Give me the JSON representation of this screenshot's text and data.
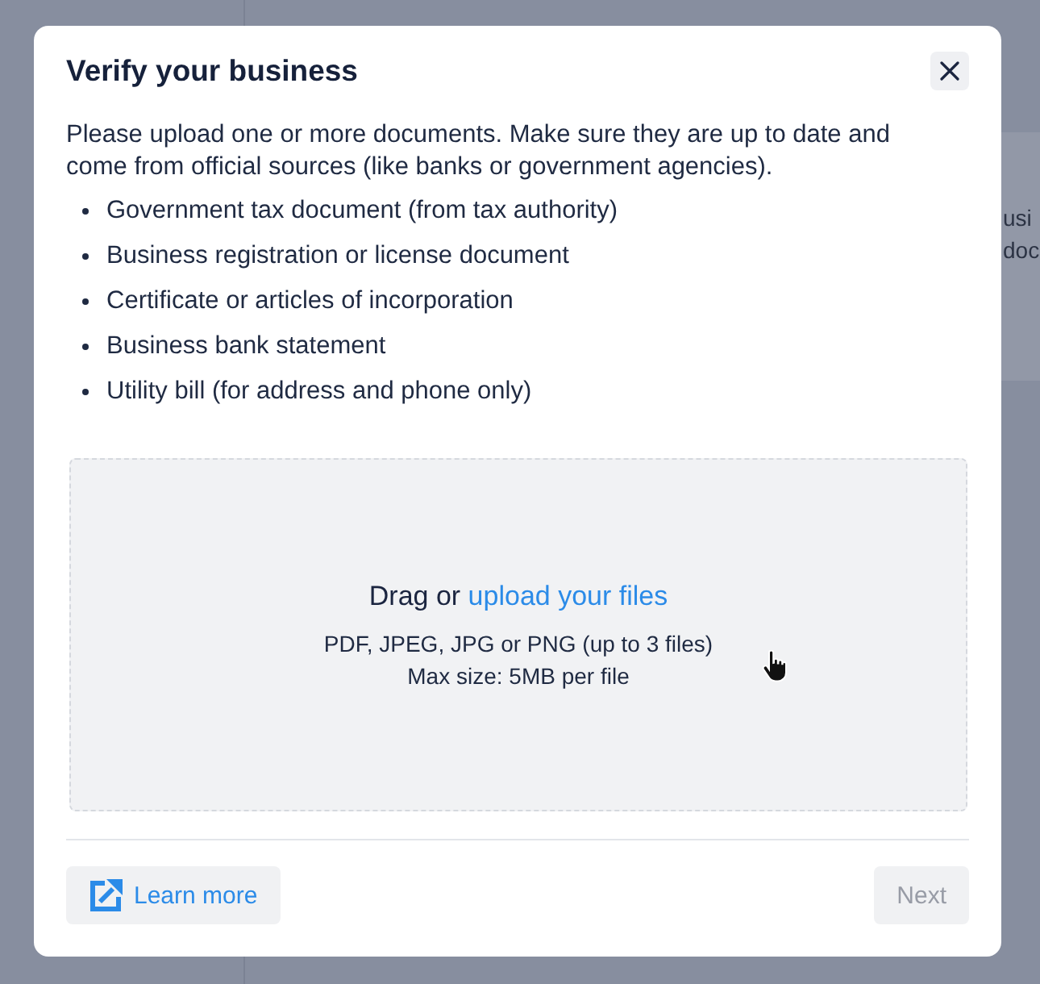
{
  "background": {
    "card_lines": [
      "usi",
      "doc"
    ]
  },
  "dialog": {
    "title": "Verify your business",
    "intro": "Please upload one or more documents. Make sure they are up to date and come from official sources (like banks or government agencies).",
    "documents": [
      "Government tax document (from tax authority)",
      "Business registration or license document",
      "Certificate or articles of incorporation",
      "Business bank statement",
      "Utility bill (for address and phone only)"
    ],
    "dropzone": {
      "prompt": "Drag or",
      "link": "upload your files",
      "formats": "PDF, JPEG, JPG or PNG (up to 3 files)",
      "max_size": "Max size: 5MB per file"
    },
    "buttons": [
      {
        "kind": "link",
        "label": "Learn more",
        "disabled": false
      },
      {
        "kind": "primary",
        "label": "Next",
        "disabled": true
      }
    ]
  }
}
